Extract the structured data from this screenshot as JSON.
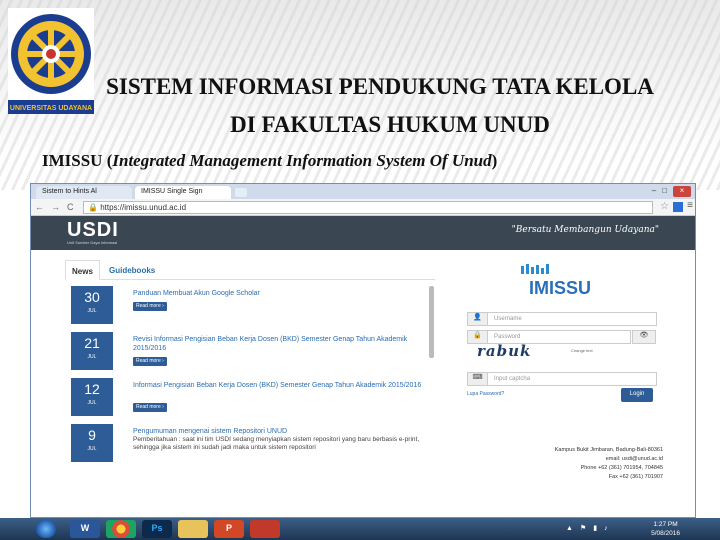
{
  "slide": {
    "title_line1": "SISTEM INFORMASI PENDUKUNG TATA KELOLA",
    "title_line2": "DI FAKULTAS HUKUM UNUD",
    "subtitle_prefix": "IMISSU (",
    "subtitle_italic": "Integrated Management Information System Of Unud",
    "subtitle_suffix": ")",
    "logo_text": "UNIVERSITAS UDAYANA"
  },
  "browser": {
    "tabs": [
      {
        "label": "Sistem to Hints Al"
      },
      {
        "label": "IMISSU Single Sign"
      }
    ],
    "url": "https://imissu.unud.ac.id",
    "nav_back": "←",
    "nav_forward": "→",
    "nav_reload": "C",
    "star": "☆",
    "menu": "≡"
  },
  "site": {
    "brand": "USDI",
    "brand_sub": "Unit Sumber Daya Informasi",
    "motto": "\"Bersatu Membangun Udayana\"",
    "tabs": [
      "News",
      "Guidebooks"
    ],
    "news": [
      {
        "day": "30",
        "month": "JUL",
        "title": "Panduan Membuat Akun Google Scholar",
        "text": "",
        "button": "Read more"
      },
      {
        "day": "21",
        "month": "JUL",
        "title": "Revisi Informasi Pengisian Beban Kerja Dosen (BKD) Semester Genap Tahun Akademik 2015/2016",
        "text": "",
        "button": "Read more"
      },
      {
        "day": "12",
        "month": "JUL",
        "title": "Informasi Pengisian Beban Kerja Dosen (BKD) Semester Genap Tahun Akademik 2015/2016",
        "text": "",
        "button": "Read more"
      },
      {
        "day": "9",
        "month": "JUL",
        "title": "Pengumuman mengenai sistem Repositori UNUD",
        "text": "Pemberitahuan : saat ini tim USDI sedang menyiapkan sistem repositori yang baru berbasis e-print, sehingga jika sistem ini sudah jadi maka untuk sistem repositori",
        "button": ""
      }
    ],
    "login": {
      "logo": "IMISSU",
      "username_placeholder": "Username",
      "password_placeholder": "Password",
      "captcha": "rabuk",
      "change_text": "Change text",
      "captcha_placeholder": "Input captcha",
      "forgot": "Lupa Password?",
      "login_button": "Login"
    },
    "address": [
      "Kampus Bukit Jimbaran, Badung-Bali-80361",
      "email: usdi@unud.ac.id",
      "Phone +62 (361) 701954, 704845",
      "Fax +62 (361) 701907"
    ]
  },
  "taskbar": {
    "apps": [
      "W",
      "",
      "Ps",
      "",
      "P",
      ""
    ],
    "time": "1:27 PM",
    "date": "5/08/2016"
  }
}
